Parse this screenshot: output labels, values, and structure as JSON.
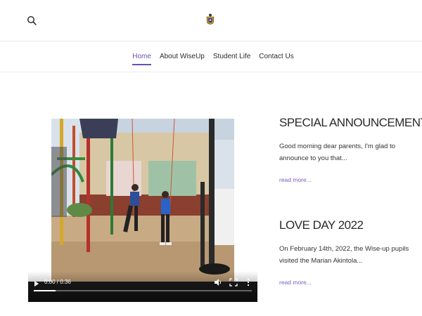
{
  "header": {
    "search_icon": "search-icon",
    "logo": "school-crest-logo"
  },
  "nav": {
    "items": [
      {
        "label": "Home",
        "active": true
      },
      {
        "label": "About WiseUp",
        "active": false
      },
      {
        "label": "Student Life",
        "active": false
      },
      {
        "label": "Contact Us",
        "active": false
      }
    ]
  },
  "video": {
    "time": "0:00 / 0:36",
    "progress": 0.1,
    "icons": [
      "play-icon",
      "volume-icon",
      "fullscreen-icon",
      "more-options-icon"
    ]
  },
  "posts": [
    {
      "title": "SPECIAL ANNOUNCEMENT !",
      "excerpt": "Good morning dear parents, I'm glad to announce to you that...",
      "read_more": "read more..."
    },
    {
      "title": "LOVE DAY 2022",
      "excerpt": "On February 14th, 2022, the Wise-up pupils visited the Marian Akintola...",
      "read_more": "read more..."
    }
  ],
  "colors": {
    "accent": "#6c4fb0",
    "link": "#7a5fc2",
    "text": "#2a2a2a"
  }
}
